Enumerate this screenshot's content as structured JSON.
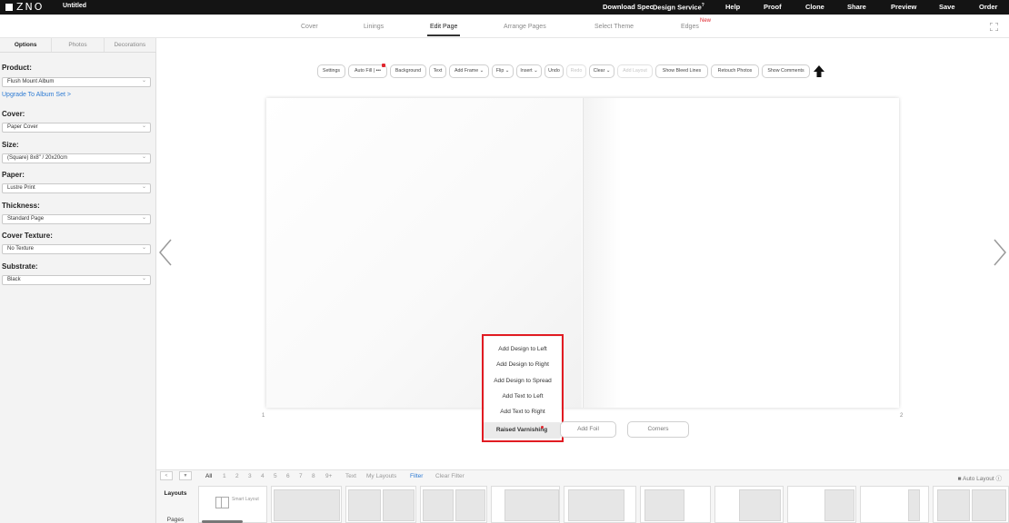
{
  "topbar": {
    "logo": "ZNO",
    "doc_title": "Untitled",
    "nav": [
      {
        "label": "Download Spec",
        "name": "nav-download-spec"
      },
      {
        "label": "Design Service",
        "name": "nav-design-service"
      },
      {
        "label": "Help",
        "name": "nav-help"
      },
      {
        "label": "Proof",
        "name": "nav-proof"
      },
      {
        "label": "Clone",
        "name": "nav-clone"
      },
      {
        "label": "Share",
        "name": "nav-share"
      },
      {
        "label": "Preview",
        "name": "nav-preview"
      },
      {
        "label": "Save",
        "name": "nav-save"
      },
      {
        "label": "Order",
        "name": "nav-order"
      }
    ],
    "design_service_badge": "?"
  },
  "tabs": [
    {
      "label": "Cover"
    },
    {
      "label": "Linings"
    },
    {
      "label": "Edit Page",
      "active": true
    },
    {
      "label": "Arrange Pages"
    },
    {
      "label": "Select Theme"
    },
    {
      "label": "Edges",
      "badge": "New"
    }
  ],
  "left_panel": {
    "tabs": [
      "Options",
      "Photos",
      "Decorations"
    ],
    "upgrade_link": "Upgrade To Album Set >",
    "options": [
      {
        "label": "Product:",
        "value": "Flush Mount Album"
      },
      {
        "label": "Cover:",
        "value": "Paper Cover"
      },
      {
        "label": "Size:",
        "value": "(Square) 8x8\" / 20x20cm"
      },
      {
        "label": "Paper:",
        "value": "Lustre Print"
      },
      {
        "label": "Thickness:",
        "value": "Standard Page"
      },
      {
        "label": "Cover Texture:",
        "value": "No Texture"
      },
      {
        "label": "Substrate:",
        "value": "Black"
      }
    ]
  },
  "toolbar": {
    "buttons": [
      {
        "label": "Settings"
      },
      {
        "label": "Auto Fill | •••",
        "badge": true
      },
      {
        "label": "Background"
      },
      {
        "label": "Text"
      },
      {
        "label": "Add Frame ⌄"
      },
      {
        "label": "Flip ⌄"
      },
      {
        "label": "Insert ⌄"
      },
      {
        "label": "Undo"
      },
      {
        "label": "Redo",
        "disabled": true
      },
      {
        "label": "Clear ⌄"
      },
      {
        "label": "Add Layout",
        "disabled": true
      },
      {
        "label": "Show Bleed Lines"
      },
      {
        "label": "Retouch Photos"
      },
      {
        "label": "Show Comments"
      }
    ]
  },
  "canvas": {
    "page_left_number": "1",
    "page_right_number": "2"
  },
  "menu": {
    "items": [
      "Add Design to Left",
      "Add Design to Right",
      "Add Design to Spread",
      "Add Text to Left",
      "Add Text to Right"
    ],
    "raised_varnishing": "Raised Varnishing",
    "add_foil": "Add Foil",
    "corners": "Corners"
  },
  "bottom": {
    "filters": [
      "All",
      "1",
      "2",
      "3",
      "4",
      "5",
      "6",
      "7",
      "8",
      "9+",
      "Text",
      "My Layouts",
      "Filter",
      "Clear Filter"
    ],
    "auto_layout": "Auto Layout",
    "side_tabs": [
      "Layouts",
      "Pages"
    ],
    "smart_layout": "Smart Layout"
  },
  "colors": {
    "accent_red": "#e11b22",
    "link_blue": "#2e7bd3",
    "topbar_bg": "#141414"
  }
}
